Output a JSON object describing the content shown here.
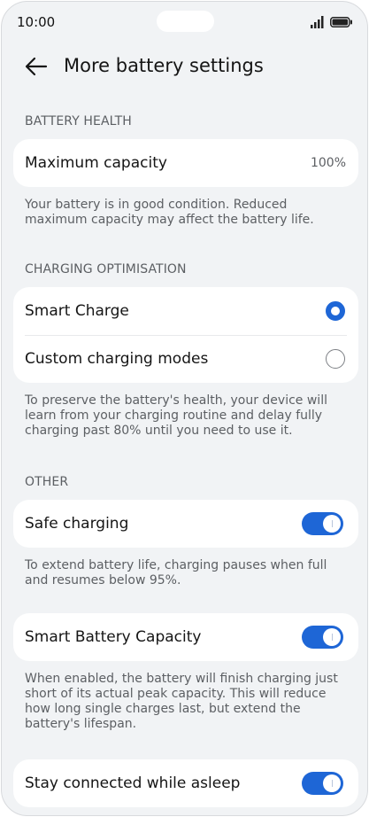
{
  "status_bar": {
    "time": "10:00"
  },
  "header": {
    "title": "More battery settings",
    "back_icon": "arrow-left-icon"
  },
  "battery_health": {
    "header": "BATTERY HEALTH",
    "max_capacity_label": "Maximum capacity",
    "max_capacity_value": "100%",
    "description": "Your battery is in good condition. Reduced maximum capacity may affect the battery life."
  },
  "charging_optimisation": {
    "header": "CHARGING OPTIMISATION",
    "options": [
      {
        "label": "Smart Charge",
        "selected": true
      },
      {
        "label": "Custom charging modes",
        "selected": false
      }
    ],
    "description": "To preserve the battery's health, your device will learn from your charging routine and delay fully charging past 80% until you need to use it."
  },
  "other": {
    "header": "OTHER",
    "safe_charging": {
      "label": "Safe charging",
      "enabled": true,
      "description": "To extend battery life, charging pauses when full and resumes below 95%."
    },
    "smart_battery_capacity": {
      "label": "Smart Battery Capacity",
      "enabled": true,
      "description": "When enabled, the battery will finish charging just short of its actual peak capacity. This will reduce how long single charges last, but extend the battery's lifespan."
    },
    "stay_connected": {
      "label": "Stay connected while asleep",
      "enabled": true
    }
  },
  "colors": {
    "accent": "#1e66d6",
    "background": "#f1f3f5",
    "card": "#ffffff"
  }
}
